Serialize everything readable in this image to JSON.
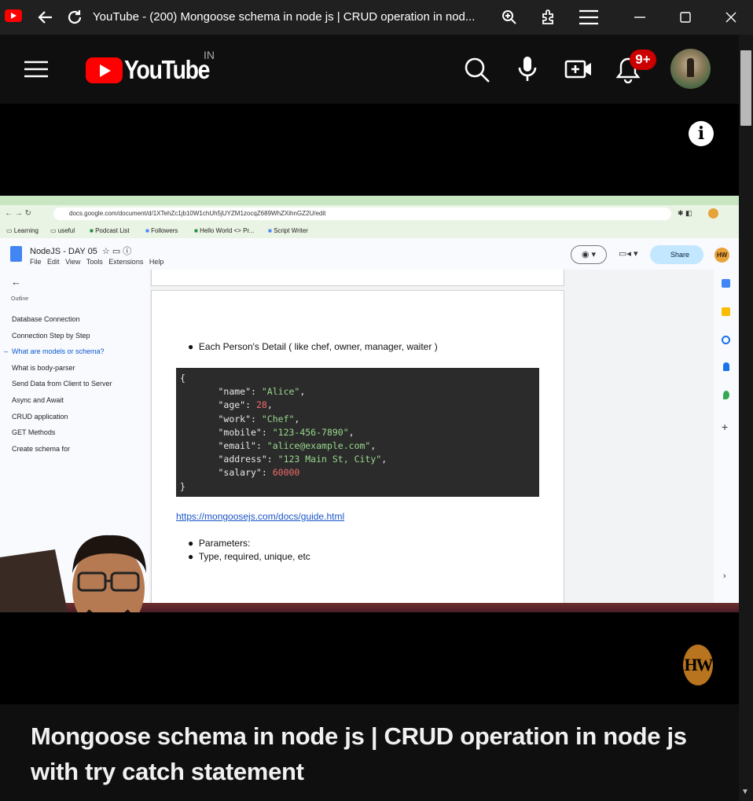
{
  "browser": {
    "title": "YouTube - (200) Mongoose schema in node js | CRUD operation in nod..."
  },
  "header": {
    "logo_text": "YouTube",
    "country": "IN",
    "notification_count": "9+"
  },
  "video": {
    "info_label": "i",
    "channel_watermark": "HW",
    "screen": {
      "url": "docs.google.com/document/d/1XTehZc1jb10W1chUh5jUYZM1zocqZ689WhZXihnGZ2U/edit",
      "bookmarks": [
        "Learning",
        "useful",
        "Podcast List",
        "Followers",
        "Hello World <> Pr...",
        "Script Writer"
      ],
      "doc_title": "NodeJS - DAY 05",
      "doc_menu": [
        "File",
        "Edit",
        "View",
        "Tools",
        "Extensions",
        "Help"
      ],
      "share_label": "Share",
      "profile_initials": "HW",
      "outline_label": "Outline",
      "outline_items": [
        "Database Connection",
        "Connection Step by Step",
        "What are models or schema?",
        "What is body-parser",
        "Send Data from Client to Server",
        "Async and Await",
        "CRUD application",
        "GET Methods",
        "Create schema for"
      ],
      "bullet_main": "Each Person's Detail ( like chef, owner, manager, waiter )",
      "code": {
        "open": "{",
        "close": "}",
        "fields": [
          {
            "key": "\"name\"",
            "value": "\"Alice\"",
            "type": "str"
          },
          {
            "key": "\"age\"",
            "value": "28",
            "type": "num"
          },
          {
            "key": "\"work\"",
            "value": "\"Chef\"",
            "type": "str"
          },
          {
            "key": "\"mobile\"",
            "value": "\"123-456-7890\"",
            "type": "str"
          },
          {
            "key": "\"email\"",
            "value": "\"alice@example.com\"",
            "type": "str"
          },
          {
            "key": "\"address\"",
            "value": "\"123 Main St, City\"",
            "type": "str"
          },
          {
            "key": "\"salary\"",
            "value": "60000",
            "type": "num"
          }
        ]
      },
      "link": "https://mongoosejs.com/docs/guide.html",
      "bullet_params": "Parameters:",
      "bullet_types": "Type, required, unique, etc"
    }
  },
  "title": {
    "line1": "Mongoose schema in node js | CRUD operation in node js",
    "line2": "with try catch statement"
  },
  "colors": {
    "accent": "#ff0000",
    "background": "#0f0f0f",
    "badge": "#cc0000"
  }
}
